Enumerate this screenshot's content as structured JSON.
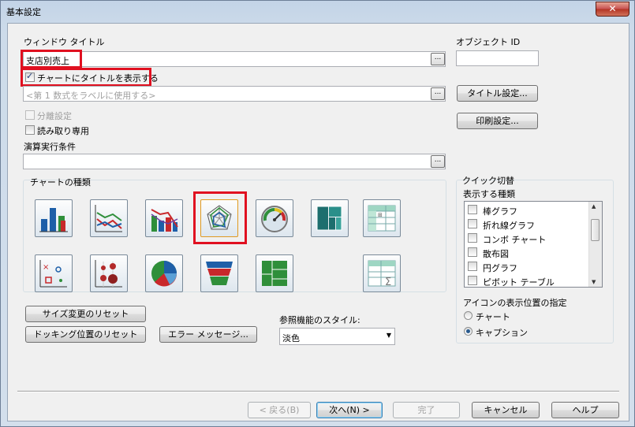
{
  "window": {
    "title": "基本設定",
    "close_glyph": "✕"
  },
  "window_title_field": {
    "label": "ウィンドウ タイトル",
    "value": "支店別売上",
    "browse": "..."
  },
  "object_id": {
    "label": "オブジェクト ID",
    "value": ""
  },
  "show_title_checkbox": {
    "label": "チャートにタイトルを表示する",
    "checked": true
  },
  "title_expr_field": {
    "placeholder": "<第 1 数式をラベルに使用する>",
    "browse": "..."
  },
  "buttons": {
    "title_settings": "タイトル設定...",
    "print_settings": "印刷設定...",
    "reset_size": "サイズ変更のリセット",
    "reset_docking": "ドッキング位置のリセット",
    "error_messages": "エラー メッセージ...",
    "back": "< 戻る(B)",
    "next": "次へ(N) >",
    "finish": "完了",
    "cancel": "キャンセル",
    "help": "ヘルプ"
  },
  "detach_checkbox": {
    "label": "分離設定",
    "checked": false,
    "disabled": true
  },
  "readonly_checkbox": {
    "label": "読み取り専用",
    "checked": false
  },
  "calc_condition": {
    "label": "演算実行条件",
    "value": "",
    "browse": "..."
  },
  "chart_types": {
    "group_label": "チャートの種類",
    "selected": "radar",
    "items": [
      "bar-chart-icon",
      "line-chart-icon",
      "combo-chart-icon",
      "radar-chart-icon",
      "gauge-chart-icon",
      "block-chart-icon",
      "pivot-table-icon",
      "scatter-chart-icon",
      "grid-chart-icon",
      "pie-chart-icon",
      "funnel-chart-icon",
      "mekko-chart-icon",
      "straight-table-icon"
    ]
  },
  "quick_switch": {
    "group_label": "クイック切替",
    "list_label": "表示する種類",
    "items": [
      {
        "label": "棒グラフ",
        "checked": false
      },
      {
        "label": "折れ線グラフ",
        "checked": false
      },
      {
        "label": "コンボ チャート",
        "checked": false
      },
      {
        "label": "散布図",
        "checked": false
      },
      {
        "label": "円グラフ",
        "checked": false
      },
      {
        "label": "ピボット テーブル",
        "checked": false
      }
    ],
    "icon_pos_label": "アイコンの表示位置の指定",
    "radio_chart": "チャート",
    "radio_caption": "キャプション",
    "icon_pos_selected": "キャプション"
  },
  "lookup_style": {
    "label": "参照機能のスタイル:",
    "value": "淡色"
  },
  "colors": {
    "highlight": "#e01020",
    "accent": "#3c7fb1"
  }
}
